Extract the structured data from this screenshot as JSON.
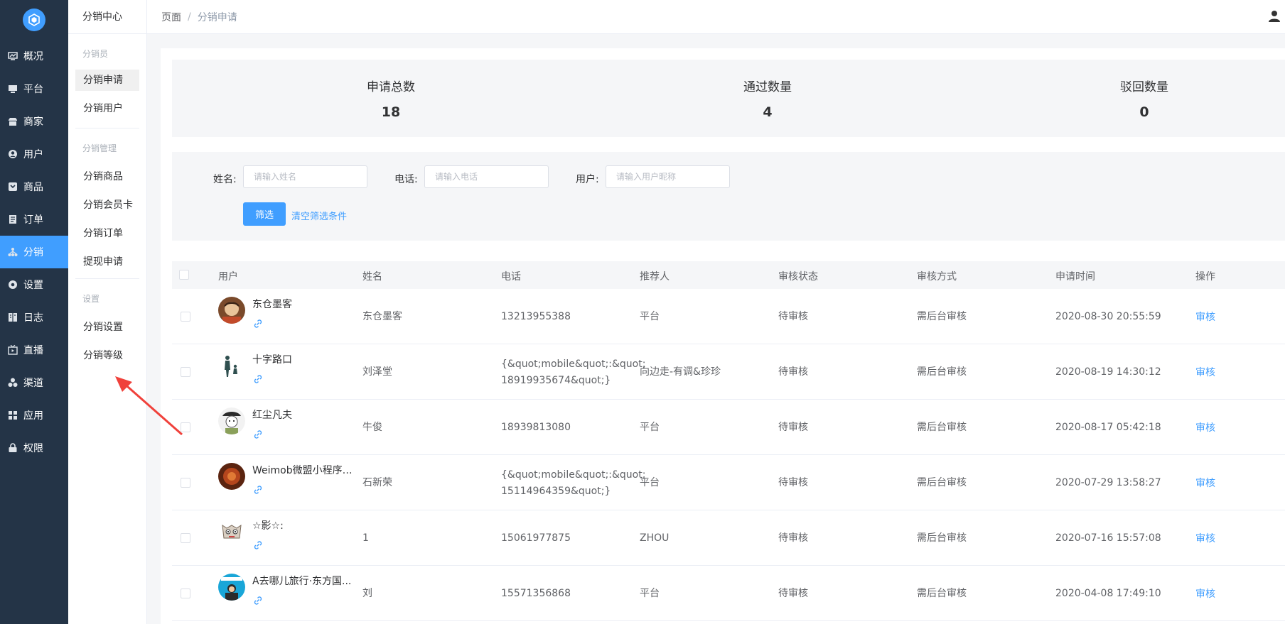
{
  "nav": {
    "items": [
      {
        "label": "概况",
        "icon": "dashboard-icon"
      },
      {
        "label": "平台",
        "icon": "monitor-icon"
      },
      {
        "label": "商家",
        "icon": "store-icon"
      },
      {
        "label": "用户",
        "icon": "user-icon"
      },
      {
        "label": "商品",
        "icon": "goods-icon"
      },
      {
        "label": "订单",
        "icon": "order-icon"
      },
      {
        "label": "分销",
        "icon": "distribution-icon",
        "active": true
      },
      {
        "label": "设置",
        "icon": "gear-icon"
      },
      {
        "label": "日志",
        "icon": "log-icon"
      },
      {
        "label": "直播",
        "icon": "live-icon"
      },
      {
        "label": "渠道",
        "icon": "channel-icon"
      },
      {
        "label": "应用",
        "icon": "apps-icon"
      },
      {
        "label": "权限",
        "icon": "lock-icon"
      }
    ]
  },
  "subnav": {
    "title": "分销中心",
    "groups": [
      {
        "title": "分销员",
        "items": [
          "分销申请",
          "分销用户"
        ]
      },
      {
        "title": "分销管理",
        "items": [
          "分销商品",
          "分销会员卡",
          "分销订单",
          "提现申请"
        ]
      },
      {
        "title": "设置",
        "items": [
          "分销设置",
          "分销等级"
        ]
      }
    ]
  },
  "breadcrumb": {
    "root": "页面",
    "sep": "/",
    "current": "分销申请"
  },
  "stats": [
    {
      "label": "申请总数",
      "value": "18"
    },
    {
      "label": "通过数量",
      "value": "4"
    },
    {
      "label": "驳回数量",
      "value": "0"
    }
  ],
  "filter": {
    "name_label": "姓名:",
    "name_placeholder": "请输入姓名",
    "phone_label": "电话:",
    "phone_placeholder": "请输入电话",
    "user_label": "用户:",
    "user_placeholder": "请输入用户昵称",
    "submit": "筛选",
    "clear": "清空筛选条件"
  },
  "table": {
    "columns": [
      "用户",
      "姓名",
      "电话",
      "推荐人",
      "审核状态",
      "审核方式",
      "申请时间",
      "操作"
    ],
    "rows": [
      {
        "nick": "东仓墨客",
        "name": "东仓墨客",
        "phone": [
          "13213955388"
        ],
        "ref": "平台",
        "status": "待审核",
        "method": "需后台审核",
        "time": "2020-08-30 20:55:59",
        "op": "审核"
      },
      {
        "nick": "十字路口",
        "name": "刘泽堂",
        "phone": [
          "{&quot;mobile&quot;:&quot;",
          "18919935674&quot;}"
        ],
        "ref": "向边走-有调&珍珍",
        "status": "待审核",
        "method": "需后台审核",
        "time": "2020-08-19 14:30:12",
        "op": "审核"
      },
      {
        "nick": "红尘凡夫",
        "name": "牛俊",
        "phone": [
          "18939813080"
        ],
        "ref": "平台",
        "status": "待审核",
        "method": "需后台审核",
        "time": "2020-08-17 05:42:18",
        "op": "审核"
      },
      {
        "nick": "Weimob微盟小程序石...",
        "name": "石新荣",
        "phone": [
          "{&quot;mobile&quot;:&quot;",
          "15114964359&quot;}"
        ],
        "ref": "平台",
        "status": "待审核",
        "method": "需后台审核",
        "time": "2020-07-29 13:58:27",
        "op": "审核"
      },
      {
        "nick": "☆影☆:",
        "name": "1",
        "phone": [
          "15061977875"
        ],
        "ref": "ZHOU",
        "status": "待审核",
        "method": "需后台审核",
        "time": "2020-07-16 15:57:08",
        "op": "审核"
      },
      {
        "nick": "A去哪儿旅行·东方国...",
        "name": "刘",
        "phone": [
          "15571356868"
        ],
        "ref": "平台",
        "status": "待审核",
        "method": "需后台审核",
        "time": "2020-04-08 17:49:10",
        "op": "审核"
      }
    ]
  },
  "colors": {
    "accent": "#409eff",
    "nav_bg": "#243447",
    "annotation": "#f0413b"
  }
}
